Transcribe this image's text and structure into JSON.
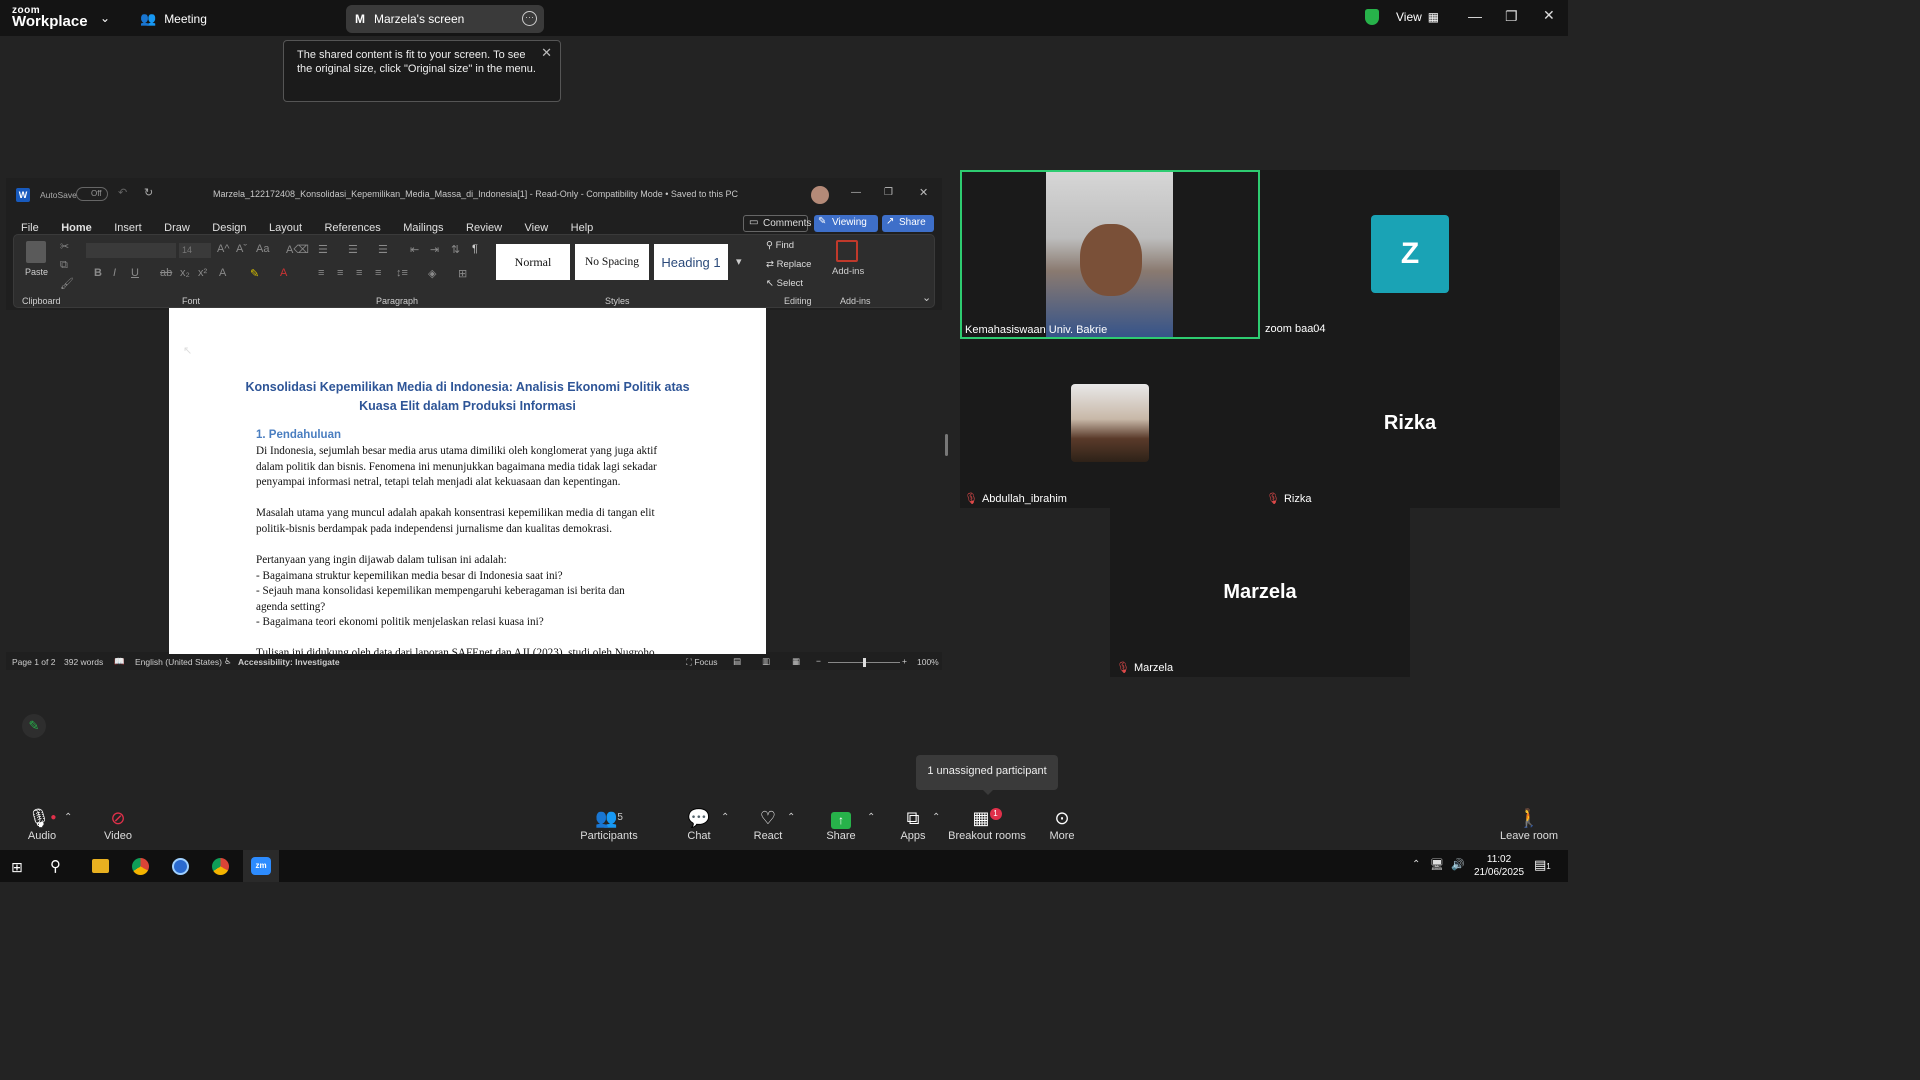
{
  "topbar": {
    "brand_line1": "zoom",
    "brand_line2": "Workplace",
    "meeting_label": "Meeting",
    "share_tab_initial": "M",
    "share_tab_title": "Marzela's screen",
    "view_label": "View",
    "tooltip_text": "The shared content is fit to your screen. To see the original size, click \"Original size\" in the menu."
  },
  "word": {
    "autosave_label": "AutoSave",
    "autosave_state": "Off",
    "title": "Marzela_122172408_Konsolidasi_Kepemilikan_Media_Massa_di_Indonesia[1]  -  Read-Only  -  Compatibility Mode  •  Saved to this PC",
    "menu": [
      "File",
      "Home",
      "Insert",
      "Draw",
      "Design",
      "Layout",
      "References",
      "Mailings",
      "Review",
      "View",
      "Help"
    ],
    "active_menu": "Home",
    "comments_label": "Comments",
    "viewing_label": "Viewing",
    "share_label": "Share",
    "ribbon": {
      "paste": "Paste",
      "clipboard": "Clipboard",
      "font_size": "14",
      "font": "Font",
      "paragraph": "Paragraph",
      "styles": [
        "Normal",
        "No Spacing",
        "Heading 1"
      ],
      "styles_label": "Styles",
      "find": "Find",
      "replace": "Replace",
      "select": "Select",
      "editing": "Editing",
      "addins": "Add-ins",
      "addins_group": "Add-ins"
    },
    "doc": {
      "title_line1": "Konsolidasi Kepemilikan Media di Indonesia: Analisis Ekonomi Politik atas",
      "title_line2": "Kuasa Elit dalam Produksi Informasi",
      "heading": "1. Pendahuluan",
      "p1": "Di Indonesia, sejumlah besar media arus utama dimiliki oleh konglomerat yang juga aktif\ndalam politik dan bisnis. Fenomena ini menunjukkan bagaimana media tidak lagi sekadar\npenyampai informasi netral, tetapi telah menjadi alat kekuasaan dan kepentingan.",
      "p2": "Masalah utama yang muncul adalah apakah konsentrasi kepemilikan media di tangan elit\npolitik-bisnis berdampak pada independensi jurnalisme dan kualitas demokrasi.",
      "p3": "Pertanyaan yang ingin dijawab dalam tulisan ini adalah:\n- Bagaimana struktur kepemilikan media besar di Indonesia saat ini?\n- Sejauh mana konsolidasi kepemilikan mempengaruhi keberagaman isi berita dan\nagenda setting?\n- Bagaimana teori ekonomi politik menjelaskan relasi kuasa ini?",
      "p4": "Tulisan ini didukung oleh data dari laporan SAFEnet dan AJI (2023), studi oleh Nugroho"
    },
    "status": {
      "page": "Page 1 of 2",
      "words": "392 words",
      "language": "English (United States)",
      "accessibility": "Accessibility: Investigate",
      "focus": "Focus",
      "zoom": "100%"
    }
  },
  "participants": {
    "p1_name": "Kemahasiswaan Univ. Bakrie",
    "p2_initial": "Z",
    "p2_name": "zoom baa04",
    "p3_name": "Abdullah_ibrahim",
    "p4_big": "Rizka",
    "p4_name": "Rizka",
    "p5_big": "Marzela",
    "p5_name": "Marzela"
  },
  "unassigned_tooltip": "1 unassigned participant",
  "toolbar": {
    "audio": "Audio",
    "video": "Video",
    "participants": "Participants",
    "participants_count": "5",
    "chat": "Chat",
    "react": "React",
    "share": "Share",
    "apps": "Apps",
    "breakout": "Breakout rooms",
    "breakout_badge": "1",
    "more": "More",
    "leave": "Leave room"
  },
  "taskbar": {
    "time": "11:02",
    "date": "21/06/2025",
    "notif_count": "1"
  },
  "colors": {
    "active_speaker_border": "#2ecc71",
    "zoom_blue_tile": "#1aa3b5",
    "doc_title": "#2e5597"
  }
}
